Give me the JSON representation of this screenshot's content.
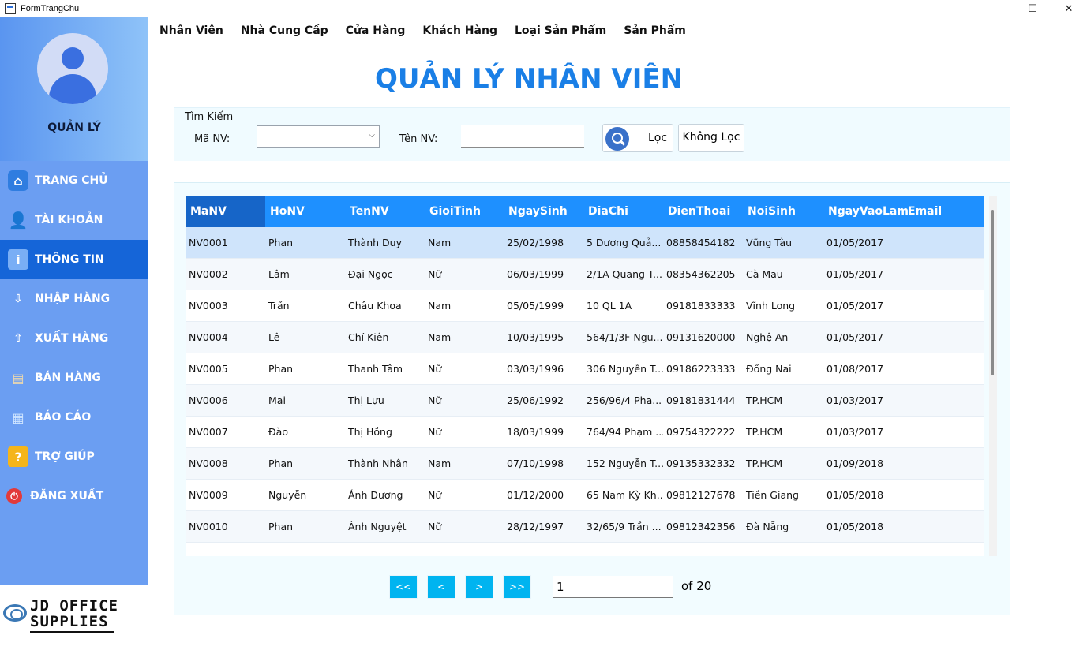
{
  "window": {
    "title": "FormTrangChu",
    "minimize": "—",
    "maximize": "☐",
    "close": "✕"
  },
  "sidebar": {
    "profile_label": "QUẢN LÝ",
    "items": [
      {
        "label": "TRANG CHỦ",
        "icon": "home-icon"
      },
      {
        "label": "TÀI KHOẢN",
        "icon": "user-icon"
      },
      {
        "label": "THÔNG TIN",
        "icon": "info-icon"
      },
      {
        "label": "NHẬP HÀNG",
        "icon": "import-icon"
      },
      {
        "label": "XUẤT HÀNG",
        "icon": "export-icon"
      },
      {
        "label": "BÁN HÀNG",
        "icon": "cart-icon"
      },
      {
        "label": "BÁO CÁO",
        "icon": "report-icon"
      },
      {
        "label": "TRỢ GIÚP",
        "icon": "help-icon"
      },
      {
        "label": "ĐĂNG XUẤT",
        "icon": "logout-icon"
      }
    ],
    "logo_line1": "JD OFFICE",
    "logo_line2": "SUPPLIES"
  },
  "menu": [
    "Nhân Viên",
    "Nhà Cung Cấp",
    "Cửa Hàng",
    "Khách Hàng",
    "Loại Sản Phẩm",
    "Sản Phẩm"
  ],
  "main": {
    "title": "QUẢN LÝ NHÂN VIÊN",
    "filter": {
      "legend": "Tìm Kiếm",
      "manv_label": "Mã NV:",
      "tennv_label": "Tên NV:",
      "filter_button": "Lọc",
      "nofilter_button": "Không Lọc"
    },
    "grid": {
      "columns": [
        "MaNV",
        "HoNV",
        "TenNV",
        "GioiTinh",
        "NgaySinh",
        "DiaChi",
        "DienThoai",
        "NoiSinh",
        "NgayVaoLam",
        "Email"
      ],
      "rows": [
        [
          "NV0001",
          "Phan",
          "Thành Duy",
          "Nam",
          "25/02/1998",
          "5 Dương Quả...",
          "08858454182",
          "Vũng Tàu",
          "01/05/2017",
          ""
        ],
        [
          "NV0002",
          "Lâm",
          "Đại Ngọc",
          "Nữ",
          "06/03/1999",
          "2/1A Quang T...",
          "08354362205",
          "Cà Mau",
          "01/05/2017",
          ""
        ],
        [
          "NV0003",
          "Trần",
          "Châu Khoa",
          "Nam",
          "05/05/1999",
          "10 QL 1A",
          "09181833333",
          "Vĩnh Long",
          "01/05/2017",
          ""
        ],
        [
          "NV0004",
          "Lê",
          "Chí Kiên",
          "Nam",
          "10/03/1995",
          "564/1/3F Ngu...",
          "09131620000",
          "Nghệ An",
          "01/05/2017",
          ""
        ],
        [
          "NV0005",
          "Phan",
          "Thanh Tâm",
          "Nữ",
          "03/03/1996",
          "306 Nguyễn T...",
          "09186223333",
          "Đồng Nai",
          "01/08/2017",
          ""
        ],
        [
          "NV0006",
          "Mai",
          "Thị Lựu",
          "Nữ",
          "25/06/1992",
          "256/96/4 Pha...",
          "09181831444",
          "TP.HCM",
          "01/03/2017",
          ""
        ],
        [
          "NV0007",
          "Đào",
          "Thị Hồng",
          "Nữ",
          "18/03/1999",
          "764/94 Phạm ...",
          "09754322222",
          "TP.HCM",
          "01/03/2017",
          ""
        ],
        [
          "NV0008",
          "Phan",
          "Thành Nhân",
          "Nam",
          "07/10/1998",
          "152 Nguyễn T...",
          "09135332332",
          "TP.HCM",
          "01/09/2018",
          ""
        ],
        [
          "NV0009",
          "Nguyễn",
          "Ánh Dương",
          "Nữ",
          "01/12/2000",
          "65 Nam Kỳ Kh...",
          "09812127678",
          "Tiền Giang",
          "01/05/2018",
          ""
        ],
        [
          "NV0010",
          "Phan",
          "Ánh Nguyệt",
          "Nữ",
          "28/12/1997",
          "32/65/9 Trần ...",
          "09812342356",
          "Đà Nẵng",
          "01/05/2018",
          ""
        ]
      ]
    },
    "pager": {
      "first": "<<",
      "prev": "<",
      "next": ">",
      "last": ">>",
      "current_page": "1",
      "of_total": "of 20"
    }
  }
}
